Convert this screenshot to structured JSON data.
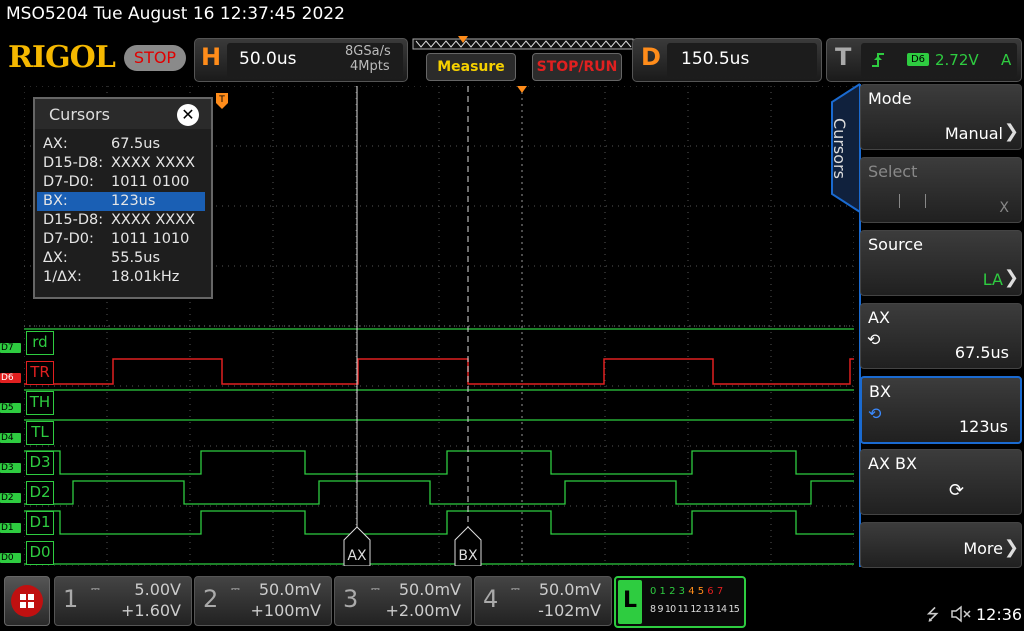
{
  "title": "MSO5204  Tue August 16 12:37:45 2022",
  "logo": "RIGOL",
  "run_state": "STOP",
  "horizontal": {
    "letter": "H",
    "timebase": "50.0us",
    "sample_rate": "8GSa/s",
    "memory_depth": "4Mpts"
  },
  "measure_button": "Measure",
  "stoprun_button": "STOP/RUN",
  "delay": {
    "letter": "D",
    "value": "150.5us"
  },
  "trigger": {
    "letter": "T",
    "source": "D6",
    "level": "2.72V",
    "mode": "A"
  },
  "cursor_box": {
    "title": "Cursors",
    "close": "✕",
    "rows": [
      {
        "key": "AX:",
        "value": "67.5us"
      },
      {
        "key": "D15-D8:",
        "value": "XXXX XXXX"
      },
      {
        "key": "D7-D0:",
        "value": "1011 0100"
      },
      {
        "key": "BX:",
        "value": "123us"
      },
      {
        "key": "D15-D8:",
        "value": "XXXX XXXX"
      },
      {
        "key": "D7-D0:",
        "value": "1011 1010"
      },
      {
        "key": "ΔX:",
        "value": "55.5us"
      },
      {
        "key": "1/ΔX:",
        "value": "18.01kHz"
      }
    ]
  },
  "channels": [
    {
      "tag": "D7",
      "name": "rd"
    },
    {
      "tag": "D6",
      "name": "TR"
    },
    {
      "tag": "D5",
      "name": "TH"
    },
    {
      "tag": "D4",
      "name": "TL"
    },
    {
      "tag": "D3",
      "name": "D3"
    },
    {
      "tag": "D2",
      "name": "D2"
    },
    {
      "tag": "D1",
      "name": "D1"
    },
    {
      "tag": "D0",
      "name": "D0"
    }
  ],
  "cursor_markers": {
    "a": "AX",
    "b": "BX"
  },
  "side_tab": "Cursors",
  "menu": {
    "mode": {
      "label": "Mode",
      "value": "Manual"
    },
    "select": {
      "label": "Select",
      "value": "X"
    },
    "source": {
      "label": "Source",
      "value": "LA"
    },
    "ax": {
      "label": "AX",
      "value": "67.5us"
    },
    "bx": {
      "label": "BX",
      "value": "123us"
    },
    "axbx": {
      "label": "AX BX"
    },
    "more": {
      "label": "More"
    }
  },
  "bottom_channels": [
    {
      "num": "1",
      "scale": "5.00V",
      "offset": "+1.60V"
    },
    {
      "num": "2",
      "scale": "50.0mV",
      "offset": "+100mV"
    },
    {
      "num": "3",
      "scale": "50.0mV",
      "offset": "+2.00mV"
    },
    {
      "num": "4",
      "scale": "50.0mV",
      "offset": "-102mV"
    }
  ],
  "logic": {
    "letter": "L",
    "row1_green": "0 1 2 3",
    "row1_orange": "4 5",
    "row1_red": "6 7",
    "row2": "8 9 10 11 12 13 14 15"
  },
  "clock": "12:36",
  "colors": {
    "accent": "#ff8c1a",
    "logo": "#f5b800",
    "logic_green": "#2ecc40",
    "trigger_red": "#e02020",
    "menu_blue": "#1a6ad0"
  }
}
